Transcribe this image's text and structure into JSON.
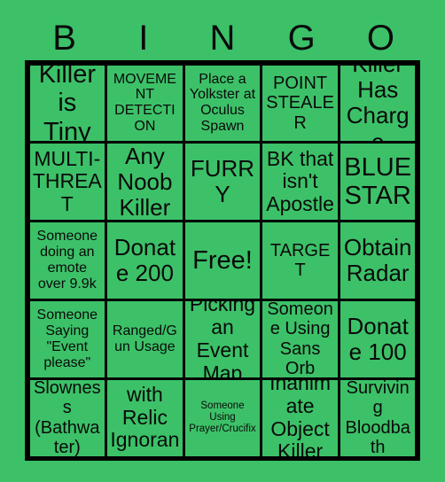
{
  "card": {
    "title": "BINGO",
    "header_letters": [
      "B",
      "I",
      "N",
      "G",
      "O"
    ],
    "colors": {
      "background": "#3cc168",
      "cell_fill": "#3cc168",
      "grid_line": "#000000",
      "text": "#0a0a0a"
    },
    "rows": 5,
    "columns": 5,
    "cells": [
      [
        {
          "text": "Killer is Tiny",
          "size": "xxl",
          "free": false
        },
        {
          "text": "MOVEMENT DETECTION",
          "size": "s",
          "free": false
        },
        {
          "text": "Place a Yolkster at Oculus Spawn",
          "size": "s",
          "free": false
        },
        {
          "text": "POINT STEALER",
          "size": "m",
          "free": false
        },
        {
          "text": "Killer Has Charge",
          "size": "xl",
          "free": false
        }
      ],
      [
        {
          "text": "MULTI-THREAT",
          "size": "l",
          "free": false
        },
        {
          "text": "Any Noob Killer",
          "size": "xl",
          "free": false
        },
        {
          "text": "FURRY",
          "size": "xl",
          "free": false
        },
        {
          "text": "BK that isn't Apostle",
          "size": "l",
          "free": false
        },
        {
          "text": "BLUE STAR",
          "size": "xxl",
          "free": false
        }
      ],
      [
        {
          "text": "Someone doing an emote over 9.9k",
          "size": "s",
          "free": false
        },
        {
          "text": "Donate 200",
          "size": "xl",
          "free": false
        },
        {
          "text": "Free!",
          "size": "xxl",
          "free": true
        },
        {
          "text": "TARGET",
          "size": "m",
          "free": false
        },
        {
          "text": "Obtain Radar",
          "size": "xl",
          "free": false
        }
      ],
      [
        {
          "text": "Someone Saying \"Event please\"",
          "size": "s",
          "free": false
        },
        {
          "text": "Ranged/Gun Usage",
          "size": "s",
          "free": false
        },
        {
          "text": "Picking an Event Map",
          "size": "l",
          "free": false
        },
        {
          "text": "Someone Using Sans Orb",
          "size": "m",
          "free": false
        },
        {
          "text": "Donate 100",
          "size": "xl",
          "free": false
        }
      ],
      [
        {
          "text": "Slowness (Bathwater)",
          "size": "m",
          "free": false
        },
        {
          "text": "Killer with Relic Ignorance",
          "size": "l",
          "free": false
        },
        {
          "text": "Someone Using Prayer/Crucifix",
          "size": "xxs",
          "free": false
        },
        {
          "text": "Inanimate Object Killer",
          "size": "l",
          "free": false
        },
        {
          "text": "Surviving Bloodbath",
          "size": "m",
          "free": false
        }
      ]
    ]
  }
}
